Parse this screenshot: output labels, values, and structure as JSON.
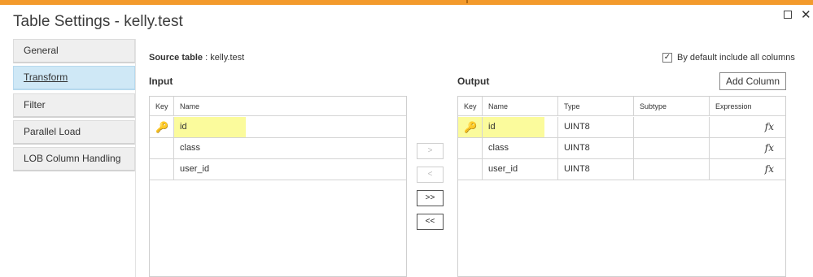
{
  "dialog": {
    "title": "Table Settings - kelly.test"
  },
  "window": {
    "maximize_icon": "square-icon",
    "close_label": "✕"
  },
  "sidebar": {
    "items": [
      {
        "label": "General",
        "active": false
      },
      {
        "label": "Transform",
        "active": true
      },
      {
        "label": "Filter",
        "active": false
      },
      {
        "label": "Parallel Load",
        "active": false
      },
      {
        "label": "LOB Column Handling",
        "active": false
      }
    ]
  },
  "source": {
    "label": "Source table",
    "separator": " : ",
    "value": "kelly.test"
  },
  "default_include": {
    "label": "By default include all columns",
    "checked": true,
    "check": "✓"
  },
  "input": {
    "title": "Input",
    "headers": {
      "key": "Key",
      "name": "Name"
    },
    "rows": [
      {
        "key": true,
        "name": "id",
        "highlight": true
      },
      {
        "key": false,
        "name": "class",
        "highlight": false
      },
      {
        "key": false,
        "name": "user_id",
        "highlight": false
      }
    ]
  },
  "transfer_buttons": [
    {
      "label": ">",
      "enabled": false
    },
    {
      "label": "<",
      "enabled": false
    },
    {
      "label": ">>",
      "enabled": true
    },
    {
      "label": "<<",
      "enabled": true
    }
  ],
  "output": {
    "title": "Output",
    "add_column_label": "Add Column",
    "headers": {
      "key": "Key",
      "name": "Name",
      "type": "Type",
      "subtype": "Subtype",
      "expression": "Expression"
    },
    "rows": [
      {
        "key": true,
        "name": "id",
        "type": "UINT8",
        "subtype": "",
        "expression": "fx",
        "highlight": true
      },
      {
        "key": false,
        "name": "class",
        "type": "UINT8",
        "subtype": "",
        "expression": "fx",
        "highlight": false
      },
      {
        "key": false,
        "name": "user_id",
        "type": "UINT8",
        "subtype": "",
        "expression": "fx",
        "highlight": false
      }
    ]
  },
  "colors": {
    "accent_bar": "#f39a2c",
    "active_tab": "#cfe8f6",
    "highlight": "#fbfb9c"
  },
  "icons": {
    "key": "key-icon",
    "expression": "function-icon"
  }
}
